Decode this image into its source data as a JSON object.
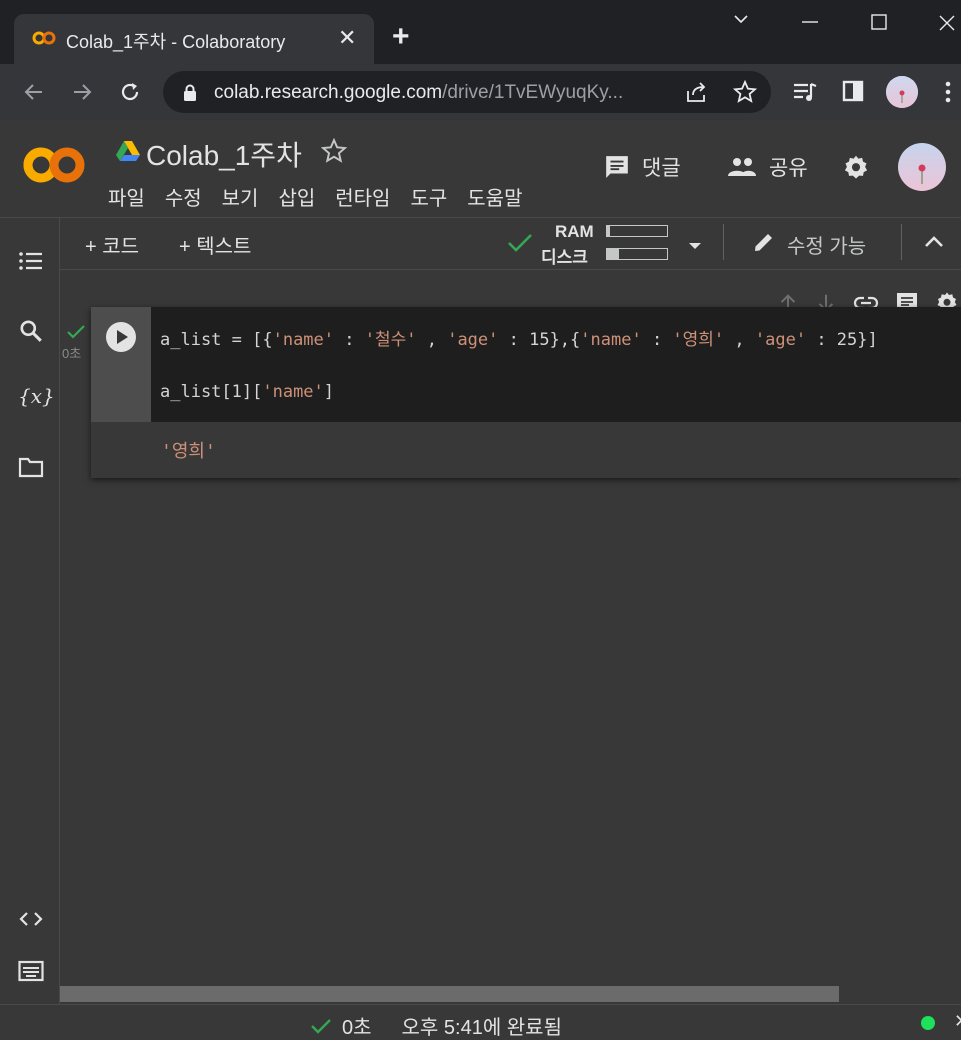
{
  "browser": {
    "tab_title": "Colab_1주차 - Colaboratory",
    "tab_close": "✕",
    "new_tab": "+",
    "url_host": "colab.research.google.com",
    "url_path": "/drive/1TvEWyuqKy...",
    "window_controls": [
      "chevron-down",
      "minimize",
      "maximize",
      "close"
    ]
  },
  "colab": {
    "logo_text": "CO",
    "notebook_title": "Colab_1주차",
    "menus": [
      "파일",
      "수정",
      "보기",
      "삽입",
      "런타임",
      "도구",
      "도움말"
    ],
    "comment_label": "댓글",
    "share_label": "공유"
  },
  "toolbar": {
    "add_code": "+ 코드",
    "add_text": "+ 텍스트",
    "ram_label": "RAM",
    "disk_label": "디스크",
    "edit_mode": "수정 가능",
    "ram_usage": 0.05,
    "disk_usage": 0.2
  },
  "cell": {
    "exec_time": "0초",
    "line1_tokens": [
      {
        "t": "a_list = [{",
        "c": "plain"
      },
      {
        "t": "'name'",
        "c": "str"
      },
      {
        "t": " : ",
        "c": "plain"
      },
      {
        "t": "'철수'",
        "c": "str"
      },
      {
        "t": " , ",
        "c": "plain"
      },
      {
        "t": "'age'",
        "c": "str"
      },
      {
        "t": " : 15},{",
        "c": "plain"
      },
      {
        "t": "'name'",
        "c": "str"
      },
      {
        "t": " : ",
        "c": "plain"
      },
      {
        "t": "'영희'",
        "c": "str"
      },
      {
        "t": " , ",
        "c": "plain"
      },
      {
        "t": "'age'",
        "c": "str"
      },
      {
        "t": " : 25}]",
        "c": "plain"
      }
    ],
    "line2_plain": "a_list[1][",
    "line2_str": "'name'",
    "line2_end": "]",
    "output": "'영희'"
  },
  "status": {
    "time": "0초",
    "completed": "오후 5:41에 완료됨"
  },
  "colors": {
    "accent_green": "#34a853",
    "colab_orange": "#f9ab00",
    "string_color": "#ce9178"
  }
}
